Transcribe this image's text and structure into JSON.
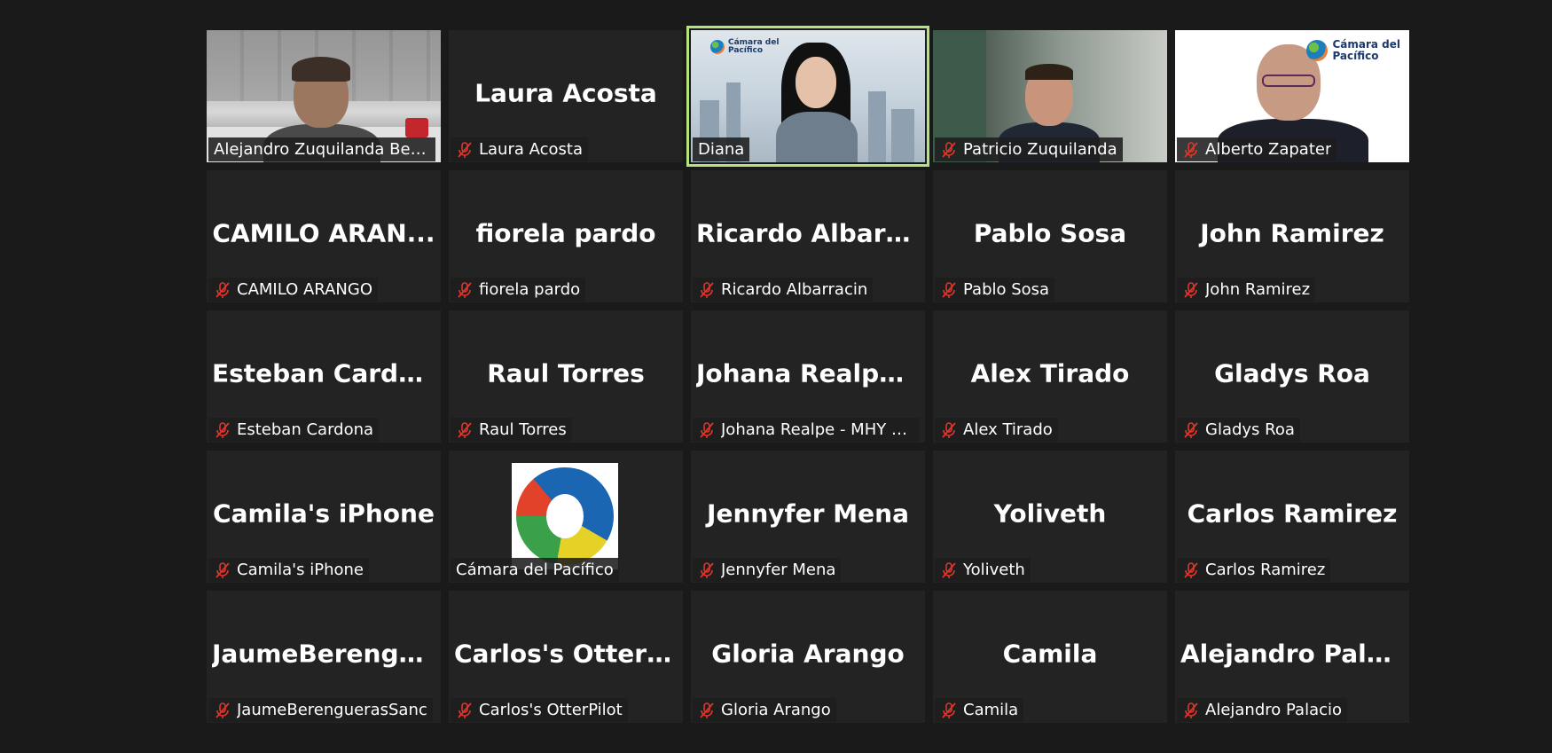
{
  "colors": {
    "background": "#1a1a1a",
    "tile": "#232323",
    "active_speaker_border": "#b7e37f",
    "mute_icon": "#e0352b"
  },
  "tiles": [
    {
      "display": "Alejandro Zuquilanda Betan...",
      "label": "Alejandro Zuquilanda Betan...",
      "muted": false,
      "video": "office"
    },
    {
      "display": "Laura Acosta",
      "label": "Laura Acosta",
      "muted": true,
      "video": "none"
    },
    {
      "display": "Diana",
      "label": "Diana",
      "muted": false,
      "video": "city",
      "speaking": true,
      "logo_line1": "Cámara del",
      "logo_line2": "Pacífico"
    },
    {
      "display": "Patricio Zuquilanda",
      "label": "Patricio Zuquilanda",
      "muted": true,
      "video": "room"
    },
    {
      "display": "Alberto Zapater",
      "label": "Alberto Zapater",
      "muted": true,
      "video": "white",
      "logo_line1": "Cámara del",
      "logo_line2": "Pacífico"
    },
    {
      "display": "CAMILO  ARAN...",
      "label": "CAMILO ARANGO",
      "muted": true,
      "video": "none"
    },
    {
      "display": "fiorela pardo",
      "label": "fiorela pardo",
      "muted": true,
      "video": "none"
    },
    {
      "display": "Ricardo  Albarra...",
      "label": "Ricardo Albarracin",
      "muted": true,
      "video": "none"
    },
    {
      "display": "Pablo Sosa",
      "label": "Pablo Sosa",
      "muted": true,
      "video": "none"
    },
    {
      "display": "John Ramirez",
      "label": "John Ramirez",
      "muted": true,
      "video": "none"
    },
    {
      "display": "Esteban Cardona",
      "label": "Esteban Cardona",
      "muted": true,
      "video": "none"
    },
    {
      "display": "Raul Torres",
      "label": "Raul Torres",
      "muted": true,
      "video": "none"
    },
    {
      "display": "Johana  Realpe  -...",
      "label": "Johana Realpe - MHY co...",
      "muted": true,
      "video": "none"
    },
    {
      "display": "Alex Tirado",
      "label": "Alex Tirado",
      "muted": true,
      "video": "none"
    },
    {
      "display": "Gladys Roa",
      "label": "Gladys Roa",
      "muted": true,
      "video": "none"
    },
    {
      "display": "Camila's iPhone",
      "label": "Camila's iPhone",
      "muted": true,
      "video": "none"
    },
    {
      "display": "",
      "label": "Cámara del Pacífico",
      "muted": false,
      "video": "avatar-logo"
    },
    {
      "display": "Jennyfer Mena",
      "label": "Jennyfer Mena",
      "muted": true,
      "video": "none"
    },
    {
      "display": "Yoliveth",
      "label": "Yoliveth",
      "muted": true,
      "video": "none"
    },
    {
      "display": "Carlos Ramirez",
      "label": "Carlos Ramirez",
      "muted": true,
      "video": "none"
    },
    {
      "display": "JaumeBerengue...",
      "label": "JaumeBerenguerasSanc",
      "muted": true,
      "video": "none"
    },
    {
      "display": "Carlos's  OtterPil...",
      "label": "Carlos's OtterPilot",
      "muted": true,
      "video": "none"
    },
    {
      "display": "Gloria Arango",
      "label": "Gloria Arango",
      "muted": true,
      "video": "none"
    },
    {
      "display": "Camila",
      "label": "Camila",
      "muted": true,
      "video": "none"
    },
    {
      "display": "Alejandro Palacio",
      "label": "Alejandro Palacio",
      "muted": true,
      "video": "none"
    }
  ]
}
